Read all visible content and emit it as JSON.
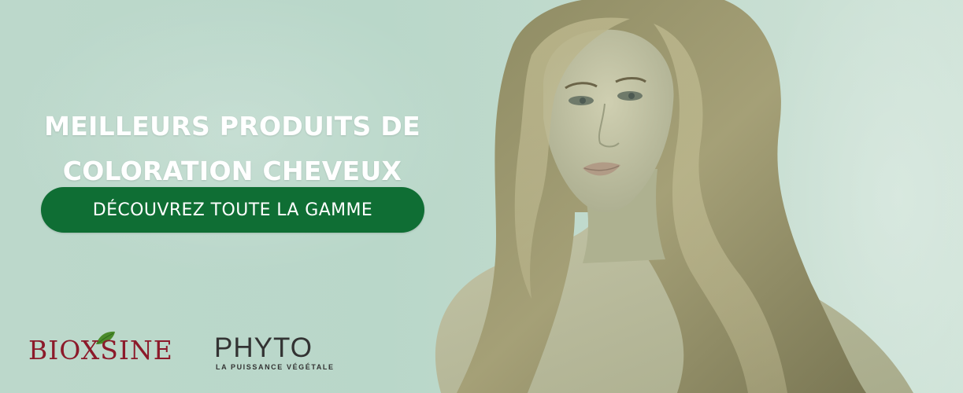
{
  "banner": {
    "headline": {
      "line1": "MEILLEURS PRODUITS DE",
      "line2": "COLORATION CHEVEUX"
    },
    "cta_label": "DÉCOUVREZ TOUTE LA GAMME",
    "brands": [
      {
        "name": "BIOXSINE"
      },
      {
        "name": "PHYTO",
        "tagline": "LA PUISSANCE VÉGÉTALE"
      }
    ]
  },
  "colors": {
    "background_tint": "#bcd8cb",
    "cta_background": "#0f6e34",
    "headline_text": "#ffffff",
    "bioxsine_brand": "#8c1a2a",
    "bioxsine_leaf": "#4a8a2a",
    "phyto_brand": "#333333"
  },
  "icons": {
    "bioxsine_leaf": "leaf-icon"
  }
}
